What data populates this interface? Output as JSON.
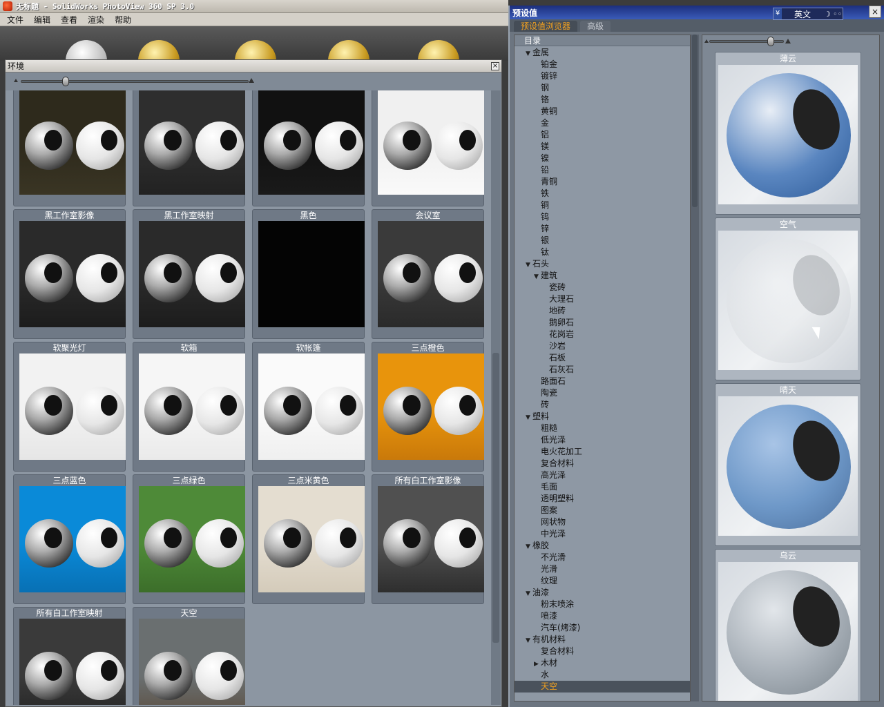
{
  "app": {
    "title": "无标题 - SolidWorks PhotoView 360 SP 3.0",
    "menu": [
      "文件",
      "编辑",
      "查看",
      "渲染",
      "帮助"
    ]
  },
  "env_panel": {
    "title": "环境",
    "close": "×",
    "environments": [
      {
        "label": "",
        "bg": "#2e2a1c",
        "floor": "#3a3524"
      },
      {
        "label": "",
        "bg": "#2e2e2e",
        "floor": "#222"
      },
      {
        "label": "",
        "bg": "#111",
        "floor": "#1a1a1a"
      },
      {
        "label": "",
        "bg": "#f0f0f0",
        "floor": "#fafafa"
      },
      {
        "label": "黑工作室影像",
        "bg": "#2a2a2a",
        "floor": "#1c1c1c"
      },
      {
        "label": "黑工作室映射",
        "bg": "#2a2a2a",
        "floor": "#1c1c1c"
      },
      {
        "label": "黑色",
        "bg": "#040404",
        "floor": "#040404"
      },
      {
        "label": "会议室",
        "bg": "#3a3a3a",
        "floor": "#2a2a2a"
      },
      {
        "label": "软聚光灯",
        "bg": "#f2f2f2",
        "floor": "#e6e6e6"
      },
      {
        "label": "软箱",
        "bg": "#f6f6f6",
        "floor": "#eaeaea"
      },
      {
        "label": "软帐篷",
        "bg": "#fafafa",
        "floor": "#efefef"
      },
      {
        "label": "三点橙色",
        "bg": "#e8940c",
        "floor": "#c9790a"
      },
      {
        "label": "三点蓝色",
        "bg": "#0a8ad8",
        "floor": "#0870b4"
      },
      {
        "label": "三点绿色",
        "bg": "#4e8a38",
        "floor": "#3c6e2a"
      },
      {
        "label": "三点米黄色",
        "bg": "#e4ddd0",
        "floor": "#d4cbba"
      },
      {
        "label": "所有白工作室影像",
        "bg": "#505050",
        "floor": "#2e2e2e"
      },
      {
        "label": "所有白工作室映射",
        "bg": "#3a3a3a",
        "floor": "#222"
      },
      {
        "label": "天空",
        "bg": "#6a6f70",
        "floor": "#5a4a3a"
      }
    ]
  },
  "preset_window": {
    "title": "预设值",
    "language": "英文",
    "close": "×",
    "tabs": [
      {
        "label": "预设值浏览器",
        "active": true
      },
      {
        "label": "高级",
        "active": false
      }
    ],
    "tree_header": "目录",
    "tree": [
      {
        "label": "金属",
        "level": 0,
        "arrow": "▼"
      },
      {
        "label": "铂金",
        "level": 1,
        "arrow": ""
      },
      {
        "label": "镀锌",
        "level": 1,
        "arrow": ""
      },
      {
        "label": "钢",
        "level": 1,
        "arrow": ""
      },
      {
        "label": "铬",
        "level": 1,
        "arrow": ""
      },
      {
        "label": "黄铜",
        "level": 1,
        "arrow": ""
      },
      {
        "label": "金",
        "level": 1,
        "arrow": ""
      },
      {
        "label": "铝",
        "level": 1,
        "arrow": ""
      },
      {
        "label": "镁",
        "level": 1,
        "arrow": ""
      },
      {
        "label": "镍",
        "level": 1,
        "arrow": ""
      },
      {
        "label": "铅",
        "level": 1,
        "arrow": ""
      },
      {
        "label": "青铜",
        "level": 1,
        "arrow": ""
      },
      {
        "label": "铁",
        "level": 1,
        "arrow": ""
      },
      {
        "label": "铜",
        "level": 1,
        "arrow": ""
      },
      {
        "label": "钨",
        "level": 1,
        "arrow": ""
      },
      {
        "label": "锌",
        "level": 1,
        "arrow": ""
      },
      {
        "label": "银",
        "level": 1,
        "arrow": ""
      },
      {
        "label": "钛",
        "level": 1,
        "arrow": ""
      },
      {
        "label": "石头",
        "level": 0,
        "arrow": "▼"
      },
      {
        "label": "建筑",
        "level": 1,
        "arrow": "▼"
      },
      {
        "label": "瓷砖",
        "level": 2,
        "arrow": ""
      },
      {
        "label": "大理石",
        "level": 2,
        "arrow": ""
      },
      {
        "label": "地砖",
        "level": 2,
        "arrow": ""
      },
      {
        "label": "鹅卵石",
        "level": 2,
        "arrow": ""
      },
      {
        "label": "花岗岩",
        "level": 2,
        "arrow": ""
      },
      {
        "label": "沙岩",
        "level": 2,
        "arrow": ""
      },
      {
        "label": "石板",
        "level": 2,
        "arrow": ""
      },
      {
        "label": "石灰石",
        "level": 2,
        "arrow": ""
      },
      {
        "label": "路面石",
        "level": 1,
        "arrow": ""
      },
      {
        "label": "陶瓷",
        "level": 1,
        "arrow": ""
      },
      {
        "label": "砖",
        "level": 1,
        "arrow": ""
      },
      {
        "label": "塑料",
        "level": 0,
        "arrow": "▼"
      },
      {
        "label": "粗糙",
        "level": 1,
        "arrow": ""
      },
      {
        "label": "低光泽",
        "level": 1,
        "arrow": ""
      },
      {
        "label": "电火花加工",
        "level": 1,
        "arrow": ""
      },
      {
        "label": "复合材料",
        "level": 1,
        "arrow": ""
      },
      {
        "label": "高光泽",
        "level": 1,
        "arrow": ""
      },
      {
        "label": "毛面",
        "level": 1,
        "arrow": ""
      },
      {
        "label": "透明塑料",
        "level": 1,
        "arrow": ""
      },
      {
        "label": "图案",
        "level": 1,
        "arrow": ""
      },
      {
        "label": "网状物",
        "level": 1,
        "arrow": ""
      },
      {
        "label": "中光泽",
        "level": 1,
        "arrow": ""
      },
      {
        "label": "橡胶",
        "level": 0,
        "arrow": "▼"
      },
      {
        "label": "不光滑",
        "level": 1,
        "arrow": ""
      },
      {
        "label": "光滑",
        "level": 1,
        "arrow": ""
      },
      {
        "label": "纹理",
        "level": 1,
        "arrow": ""
      },
      {
        "label": "油漆",
        "level": 0,
        "arrow": "▼"
      },
      {
        "label": "粉末喷涂",
        "level": 1,
        "arrow": ""
      },
      {
        "label": "喷漆",
        "level": 1,
        "arrow": ""
      },
      {
        "label": "汽车(烤漆)",
        "level": 1,
        "arrow": ""
      },
      {
        "label": "有机材料",
        "level": 0,
        "arrow": "▼"
      },
      {
        "label": "复合材料",
        "level": 1,
        "arrow": ""
      },
      {
        "label": "木材",
        "level": 1,
        "arrow": "▶"
      },
      {
        "label": "水",
        "level": 1,
        "arrow": ""
      },
      {
        "label": "天空",
        "level": 1,
        "arrow": "",
        "selected": true
      }
    ],
    "previews": [
      {
        "label": "薄云",
        "ball": "radial-gradient(circle at 35% 30%,#e8eef6,#5a86c0 55%,#2c5a98)"
      },
      {
        "label": "空气",
        "ball": "radial-gradient(circle at 40% 35%,rgba(255,255,255,0.3),rgba(200,205,210,0.5))"
      },
      {
        "label": "晴天",
        "ball": "radial-gradient(circle at 38% 32%,#a8c4e6,#6e98c8 55%,#4a6e9c)"
      },
      {
        "label": "乌云",
        "ball": "radial-gradient(circle at 38% 32%,#e2e6ea,#a8b0b8 55%,#7a848c)"
      }
    ]
  }
}
